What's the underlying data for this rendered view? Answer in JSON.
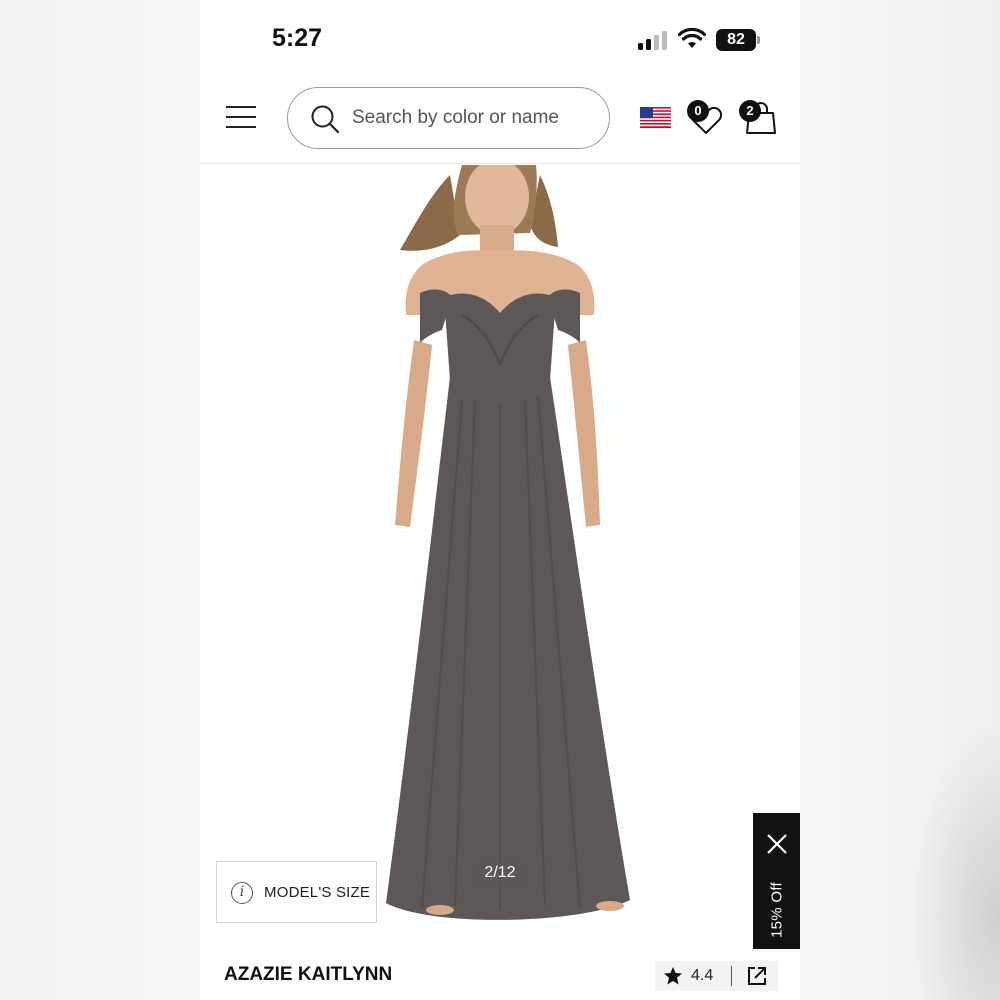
{
  "status_bar": {
    "time": "5:27",
    "battery": "82",
    "icons": [
      "signal-icon",
      "wifi-icon",
      "battery-icon"
    ]
  },
  "header": {
    "search": {
      "placeholder": "Search by color or name",
      "value": ""
    },
    "wishlist_count": "0",
    "cart_count": "2",
    "icons": [
      "menu-icon",
      "search-icon",
      "us-flag-icon",
      "heart-icon",
      "shopping-bag-icon"
    ]
  },
  "gallery": {
    "counter": "2/12",
    "model_size_label": "MODEL'S SIZE",
    "dress_color": "#5e5758"
  },
  "promo": {
    "label": "15% Off"
  },
  "product": {
    "name": "AZAZIE KAITLYNN",
    "rating": "4.4"
  },
  "colors": {
    "accent": "#111111",
    "border": "#9b9b9b"
  }
}
